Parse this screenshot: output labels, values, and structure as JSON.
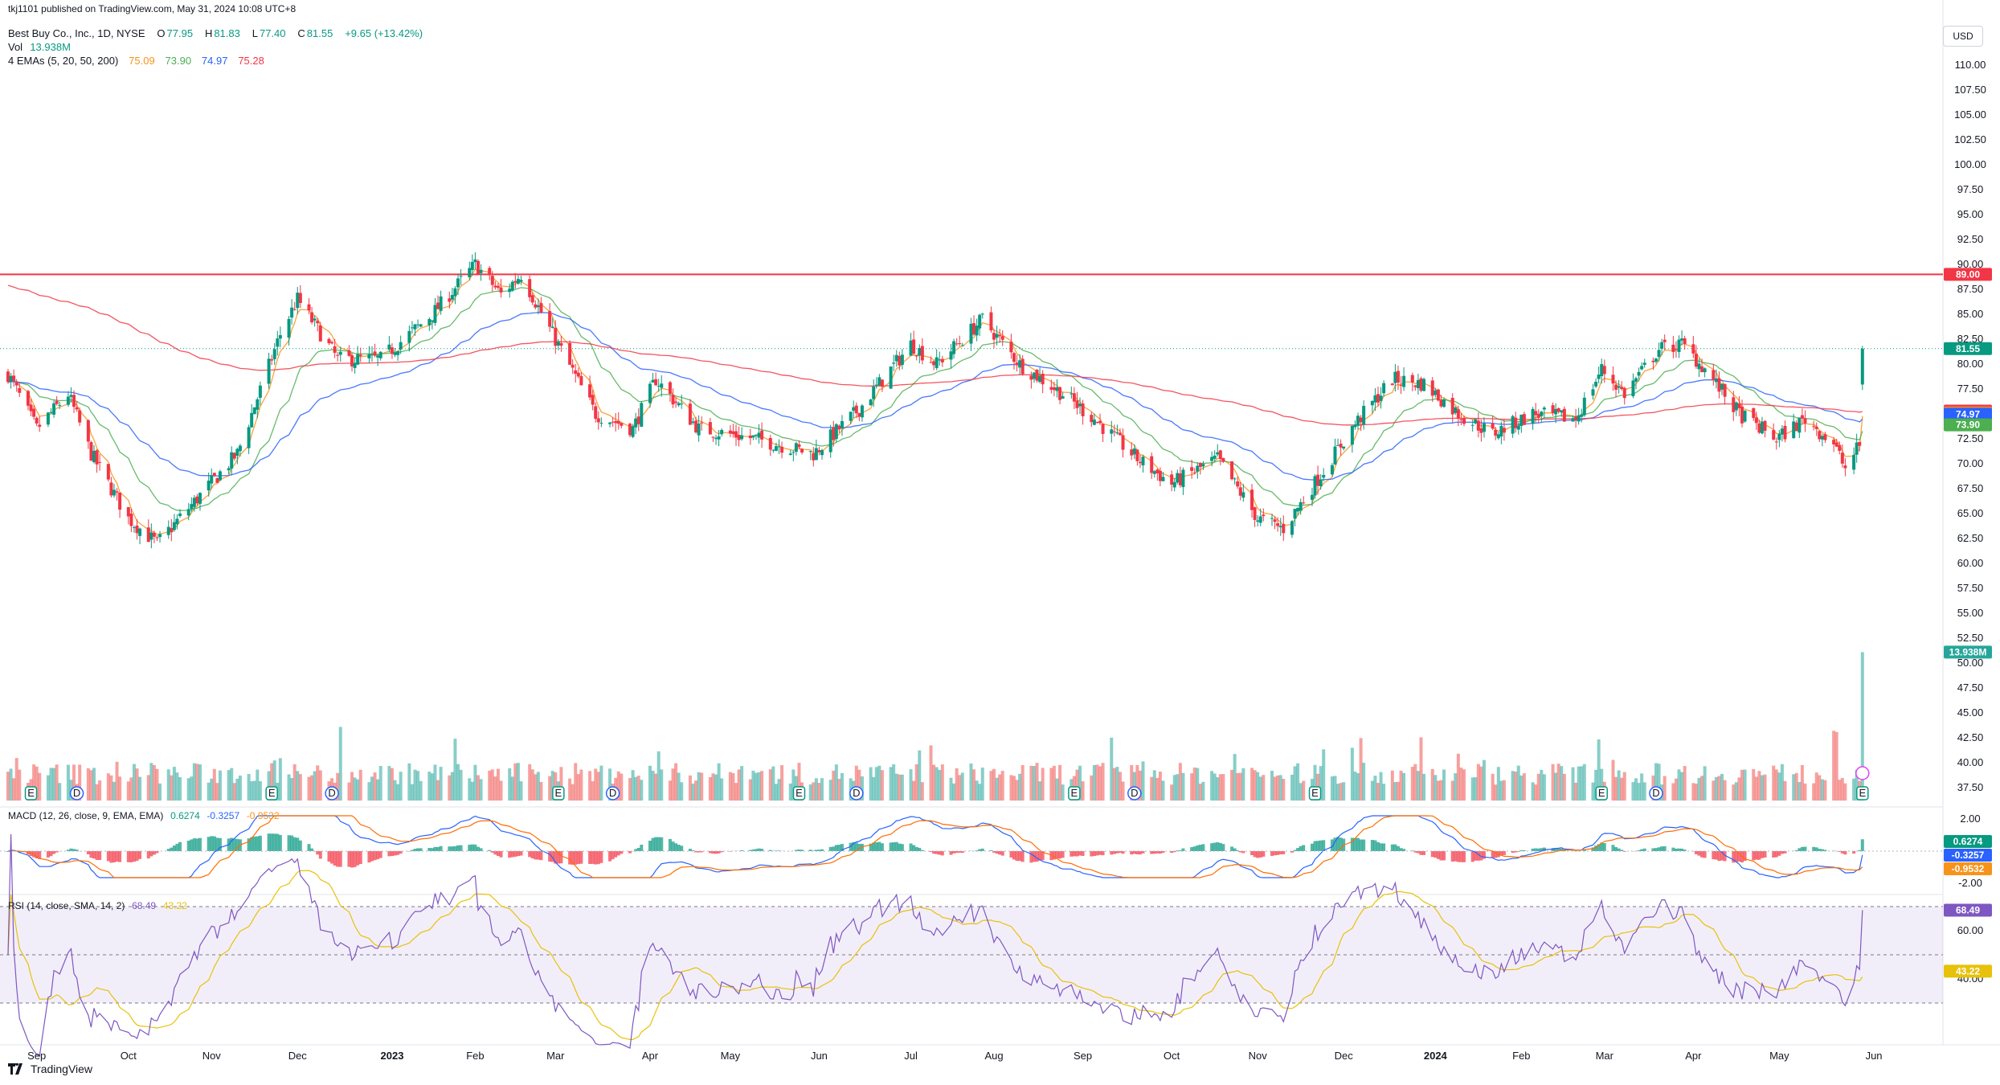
{
  "header": {
    "published": "tkj1101 published on TradingView.com, May 31, 2024 10:08 UTC+8",
    "symbol": "Best Buy Co., Inc., 1D, NYSE",
    "open_label": "O",
    "open": "77.95",
    "high_label": "H",
    "high": "81.83",
    "low_label": "L",
    "low": "77.40",
    "close_label": "C",
    "close": "81.55",
    "change": "+9.65 (+13.42%)",
    "vol_label": "Vol",
    "vol": "13.938M",
    "ema_label": "4 EMAs (5, 20, 50, 200)",
    "ema5": "75.09",
    "ema20": "73.90",
    "ema50": "74.97",
    "ema200": "75.28"
  },
  "currency": "USD",
  "macd_header": {
    "label": "MACD (12, 26, close, 9, EMA, EMA)",
    "macd": "0.6274",
    "signal": "-0.3257",
    "hist": "-0.9532"
  },
  "rsi_header": {
    "label": "RSI (14, close, SMA, 14, 2)",
    "rsi": "68.49",
    "sma": "43.22"
  },
  "footer": {
    "brand": "TradingView"
  },
  "colors": {
    "up": "#089981",
    "down": "#f23645",
    "ema5": "#f7931a",
    "ema20": "#4caf50",
    "ema50": "#2962ff",
    "ema200": "#f23645",
    "resistance": "#f23645",
    "rsi": "#7e57c2",
    "rsi_sma": "#e8c10a"
  },
  "chart_data": {
    "type": "candlestick",
    "resistance_level": 89.0,
    "price_axis": {
      "ticks": [
        "110.00",
        "107.50",
        "105.00",
        "102.50",
        "100.00",
        "97.50",
        "95.00",
        "92.50",
        "90.00",
        "87.50",
        "85.00",
        "82.50",
        "80.00",
        "77.50",
        "75.00",
        "72.50",
        "70.00",
        "67.50",
        "65.00",
        "62.50",
        "60.00",
        "57.50",
        "55.00",
        "52.50",
        "50.00",
        "47.50",
        "45.00",
        "42.50",
        "40.00",
        "37.50"
      ]
    },
    "time_axis": [
      "Sep",
      "Oct",
      "Nov",
      "Dec",
      "2023",
      "Feb",
      "Mar",
      "Apr",
      "May",
      "Jun",
      "Jul",
      "Aug",
      "Sep",
      "Oct",
      "Nov",
      "Dec",
      "2024",
      "Feb",
      "Mar",
      "Apr",
      "May",
      "Jun"
    ],
    "price_path": [
      {
        "t": "2022-08-22",
        "p": 79.0
      },
      {
        "t": "2022-09-01",
        "p": 73.5
      },
      {
        "t": "2022-09-12",
        "p": 77.0
      },
      {
        "t": "2022-09-20",
        "p": 71.0
      },
      {
        "t": "2022-10-03",
        "p": 64.5
      },
      {
        "t": "2022-10-13",
        "p": 62.0
      },
      {
        "t": "2022-10-27",
        "p": 66.5
      },
      {
        "t": "2022-11-10",
        "p": 71.0
      },
      {
        "t": "2022-11-25",
        "p": 83.0
      },
      {
        "t": "2022-12-01",
        "p": 86.5
      },
      {
        "t": "2022-12-15",
        "p": 80.5
      },
      {
        "t": "2022-12-30",
        "p": 80.5
      },
      {
        "t": "2023-01-17",
        "p": 85.0
      },
      {
        "t": "2023-02-01",
        "p": 90.0
      },
      {
        "t": "2023-02-10",
        "p": 87.0
      },
      {
        "t": "2023-02-17",
        "p": 89.0
      },
      {
        "t": "2023-02-28",
        "p": 83.0
      },
      {
        "t": "2023-03-15",
        "p": 75.0
      },
      {
        "t": "2023-03-28",
        "p": 73.5
      },
      {
        "t": "2023-04-05",
        "p": 78.5
      },
      {
        "t": "2023-04-20",
        "p": 73.5
      },
      {
        "t": "2023-05-10",
        "p": 72.5
      },
      {
        "t": "2023-05-30",
        "p": 71.0
      },
      {
        "t": "2023-06-15",
        "p": 75.5
      },
      {
        "t": "2023-07-03",
        "p": 82.0
      },
      {
        "t": "2023-07-12",
        "p": 80.0
      },
      {
        "t": "2023-07-28",
        "p": 84.5
      },
      {
        "t": "2023-08-10",
        "p": 80.0
      },
      {
        "t": "2023-08-25",
        "p": 77.0
      },
      {
        "t": "2023-09-05",
        "p": 74.5
      },
      {
        "t": "2023-09-20",
        "p": 70.5
      },
      {
        "t": "2023-10-02",
        "p": 68.0
      },
      {
        "t": "2023-10-18",
        "p": 70.5
      },
      {
        "t": "2023-11-01",
        "p": 64.5
      },
      {
        "t": "2023-11-10",
        "p": 63.5
      },
      {
        "t": "2023-11-22",
        "p": 68.5
      },
      {
        "t": "2023-12-05",
        "p": 74.0
      },
      {
        "t": "2023-12-18",
        "p": 78.5
      },
      {
        "t": "2023-12-29",
        "p": 78.0
      },
      {
        "t": "2024-01-10",
        "p": 75.0
      },
      {
        "t": "2024-01-22",
        "p": 73.0
      },
      {
        "t": "2024-02-05",
        "p": 75.0
      },
      {
        "t": "2024-02-20",
        "p": 74.5
      },
      {
        "t": "2024-02-29",
        "p": 79.5
      },
      {
        "t": "2024-03-08",
        "p": 77.0
      },
      {
        "t": "2024-03-20",
        "p": 81.5
      },
      {
        "t": "2024-03-28",
        "p": 82.0
      },
      {
        "t": "2024-04-05",
        "p": 79.5
      },
      {
        "t": "2024-04-17",
        "p": 75.0
      },
      {
        "t": "2024-04-30",
        "p": 72.5
      },
      {
        "t": "2024-05-10",
        "p": 74.5
      },
      {
        "t": "2024-05-20",
        "p": 72.0
      },
      {
        "t": "2024-05-24",
        "p": 69.5
      },
      {
        "t": "2024-05-29",
        "p": 71.9
      },
      {
        "t": "2024-05-30",
        "p": 81.55
      }
    ],
    "last_bar": {
      "open": 77.95,
      "high": 81.83,
      "low": 77.4,
      "close": 81.55,
      "volume": "13.938M"
    },
    "emas": {
      "ema5": 75.09,
      "ema20": 73.9,
      "ema50": 74.97,
      "ema200": 75.28
    },
    "price_tags": [
      {
        "label": "89.00",
        "value": 89.0,
        "color": "#f23645"
      },
      {
        "label": "81.55",
        "value": 81.55,
        "color": "#089981"
      },
      {
        "label": "75.28",
        "value": 75.28,
        "color": "#f23645"
      },
      {
        "label": "75.09",
        "value": 75.09,
        "color": "#f7931a"
      },
      {
        "label": "74.97",
        "value": 74.97,
        "color": "#2962ff"
      },
      {
        "label": "73.90",
        "value": 73.9,
        "color": "#4caf50"
      },
      {
        "label": "13.938M",
        "value": 51.1,
        "color": "#26a69a"
      }
    ],
    "events": [
      {
        "kind": "E",
        "t": "2022-08-30"
      },
      {
        "kind": "D",
        "t": "2022-09-15"
      },
      {
        "kind": "E",
        "t": "2022-11-22"
      },
      {
        "kind": "D",
        "t": "2022-12-13"
      },
      {
        "kind": "E",
        "t": "2023-03-02"
      },
      {
        "kind": "D",
        "t": "2023-03-21"
      },
      {
        "kind": "E",
        "t": "2023-05-25"
      },
      {
        "kind": "D",
        "t": "2023-06-14"
      },
      {
        "kind": "E",
        "t": "2023-08-29"
      },
      {
        "kind": "D",
        "t": "2023-09-19"
      },
      {
        "kind": "E",
        "t": "2023-11-21"
      },
      {
        "kind": "E",
        "t": "2024-02-29"
      },
      {
        "kind": "D",
        "t": "2024-03-19"
      },
      {
        "kind": "E",
        "t": "2024-05-30"
      }
    ],
    "macd_axis": [
      "2.00",
      "0.00",
      "-2.00"
    ],
    "macd_tags": [
      {
        "label": "0.6274",
        "color": "#089981"
      },
      {
        "label": "-0.3257",
        "color": "#2962ff"
      },
      {
        "label": "-0.9532",
        "color": "#f7931a"
      }
    ],
    "rsi_axis": [
      "60.00",
      "40.00"
    ],
    "rsi_tags": [
      {
        "label": "68.49",
        "color": "#7e57c2"
      },
      {
        "label": "43.22",
        "color": "#e8c10a"
      }
    ]
  }
}
